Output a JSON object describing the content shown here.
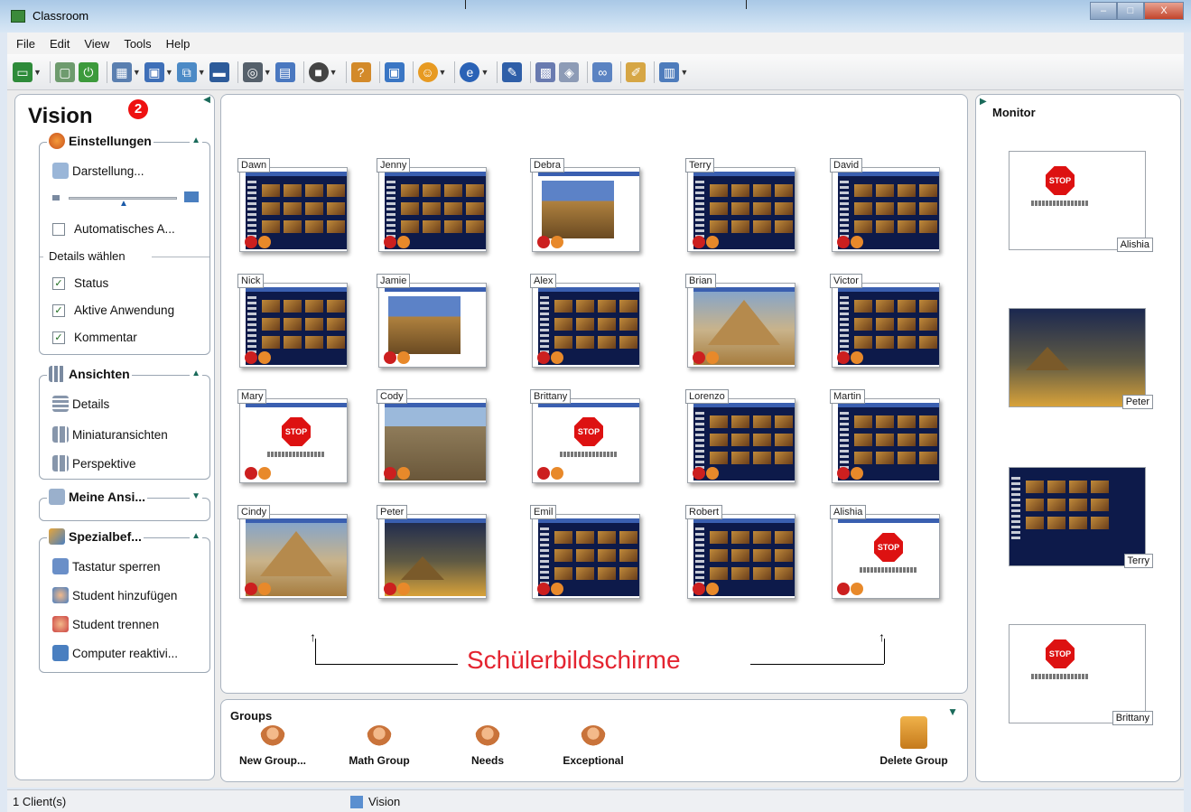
{
  "window": {
    "title": "Classroom",
    "buttons": [
      "–",
      "□",
      "X"
    ]
  },
  "menu": [
    "File",
    "Edit",
    "View",
    "Tools",
    "Help"
  ],
  "toolbar": {
    "icons": [
      "presentation-icon",
      "stop-icon",
      "power-icon",
      "thumbnails-icon",
      "monitor-icon",
      "network-icon",
      "screen-icon",
      "binoculars-icon",
      "monitor-view-icon",
      "stop-sign-icon",
      "quiz-icon",
      "screen-share-icon",
      "smiley-icon",
      "internet-icon",
      "pen-icon",
      "camera-icon",
      "video-icon",
      "link-icon",
      "edit-icon",
      "layout-icon"
    ]
  },
  "sidebar": {
    "title": "Vision",
    "badge": "2",
    "settings": {
      "header": "Einstellungen",
      "darstellung": "Darstellung...",
      "auto": "Automatisches A...",
      "details_label": "Details wählen",
      "checks": [
        {
          "label": "Status",
          "checked": true
        },
        {
          "label": "Aktive Anwendung",
          "checked": true
        },
        {
          "label": "Kommentar",
          "checked": true
        }
      ]
    },
    "views": {
      "header": "Ansichten",
      "items": [
        "Details",
        "Miniaturansichten",
        "Perspektive"
      ]
    },
    "my_views": {
      "header": "Meine Ansi..."
    },
    "special": {
      "header": "Spezialbef...",
      "items": [
        "Tastatur sperren",
        "Student hinzufügen",
        "Student trennen",
        "Computer reaktivi..."
      ]
    }
  },
  "students": [
    {
      "name": "Dawn",
      "screen": "dark"
    },
    {
      "name": "Jenny",
      "screen": "dark"
    },
    {
      "name": "Debra",
      "screen": "sphinx"
    },
    {
      "name": "Terry",
      "screen": "dark"
    },
    {
      "name": "David",
      "screen": "dark"
    },
    {
      "name": "Nick",
      "screen": "dark"
    },
    {
      "name": "Jamie",
      "screen": "sphinx"
    },
    {
      "name": "Alex",
      "screen": "dark"
    },
    {
      "name": "Brian",
      "screen": "pyr"
    },
    {
      "name": "Victor",
      "screen": "dark"
    },
    {
      "name": "Mary",
      "screen": "stop"
    },
    {
      "name": "Cody",
      "screen": "avenue"
    },
    {
      "name": "Brittany",
      "screen": "stop"
    },
    {
      "name": "Lorenzo",
      "screen": "dark"
    },
    {
      "name": "Martin",
      "screen": "dark"
    },
    {
      "name": "Cindy",
      "screen": "pyr"
    },
    {
      "name": "Peter",
      "screen": "sunset"
    },
    {
      "name": "Emil",
      "screen": "dark"
    },
    {
      "name": "Robert",
      "screen": "dark"
    },
    {
      "name": "Alishia",
      "screen": "stop"
    }
  ],
  "stop_text": "STOP",
  "annotation": "Schülerbildschirme",
  "groups": {
    "title": "Groups",
    "buttons": [
      "New Group...",
      "Math Group",
      "Needs",
      "Exceptional",
      "Delete Group"
    ]
  },
  "monitor": {
    "title": "Monitor",
    "items": [
      {
        "name": "Alishia",
        "screen": "stop"
      },
      {
        "name": "Peter",
        "screen": "sunset"
      },
      {
        "name": "Terry",
        "screen": "dark"
      },
      {
        "name": "Brittany",
        "screen": "stop"
      }
    ]
  },
  "status": {
    "clients": "1 Client(s)",
    "view": "Vision"
  }
}
